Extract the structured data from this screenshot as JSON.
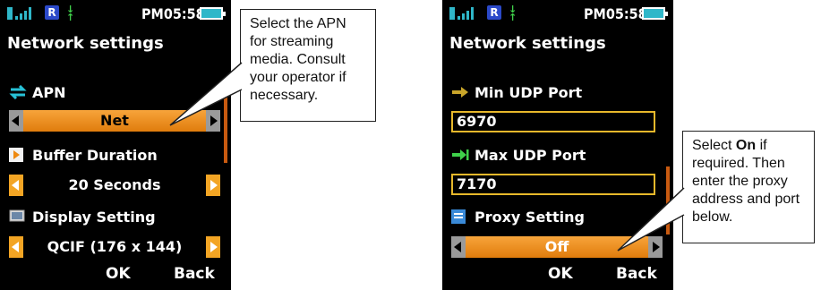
{
  "screen1": {
    "status": {
      "time": "PM05:58"
    },
    "title": "Network settings",
    "apn": {
      "label": "APN",
      "value": "Net"
    },
    "buffer": {
      "label": "Buffer Duration",
      "value": "20 Seconds"
    },
    "display": {
      "label": "Display Setting",
      "value": "QCIF (176 x 144)"
    },
    "softkeys": {
      "ok": "OK",
      "back": "Back"
    }
  },
  "screen2": {
    "status": {
      "time": "PM05:58"
    },
    "title": "Network settings",
    "min_udp": {
      "label": "Min UDP Port",
      "value": "6970"
    },
    "max_udp": {
      "label": "Max UDP Port",
      "value": "7170"
    },
    "proxy": {
      "label": "Proxy Setting",
      "value": "Off"
    },
    "softkeys": {
      "ok": "OK",
      "back": "Back"
    }
  },
  "callouts": {
    "apn_note": "Select the APN for streaming media. Consult your operator if necessary.",
    "proxy_note": {
      "prefix": "Select ",
      "bold": "On",
      "suffix": " if required. Then enter the proxy address and port below."
    }
  },
  "colors": {
    "highlight": "#ee8a12",
    "input_border": "#e7b82b",
    "accent_cyan": "#2fb7c9"
  }
}
